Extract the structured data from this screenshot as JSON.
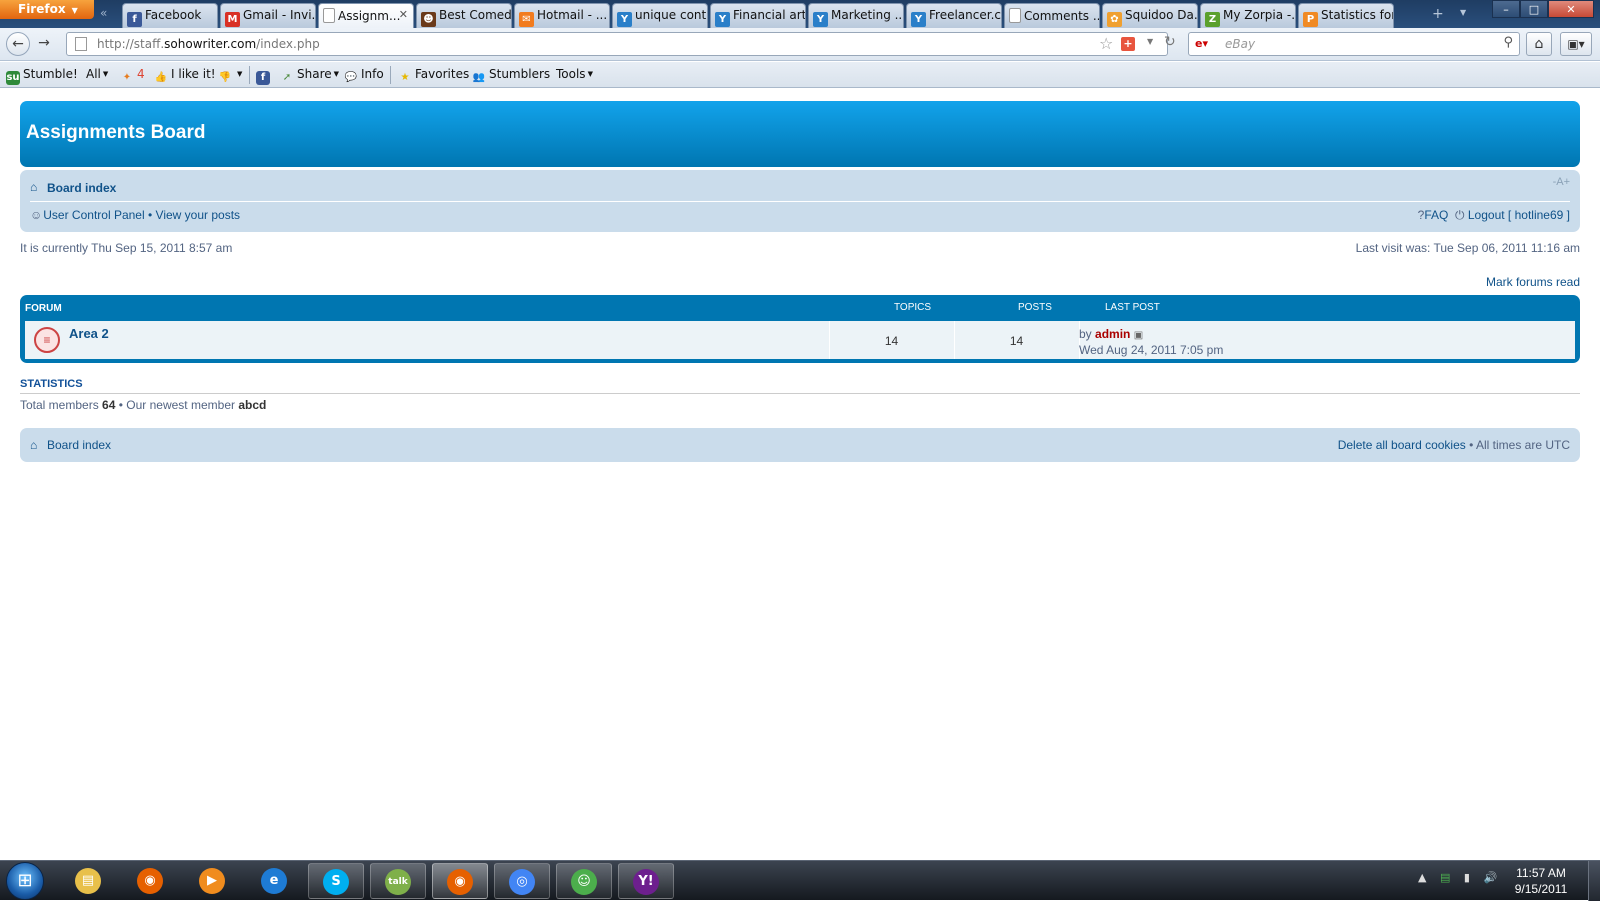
{
  "browser": {
    "app_button": "Firefox",
    "tabs": [
      {
        "title": "Facebook",
        "icon": "facebook-icon",
        "color": "#3b5998",
        "glyph": "f"
      },
      {
        "title": "Gmail - Invi...",
        "icon": "gmail-icon",
        "color": "#d93025",
        "glyph": "M"
      },
      {
        "title": "Assignm...",
        "icon": "page-icon",
        "color": "#ffffff",
        "glyph": "",
        "active": true
      },
      {
        "title": "Best Comed...",
        "icon": "mask-icon",
        "color": "#6b3a1a",
        "glyph": "☻"
      },
      {
        "title": "Hotmail - ...",
        "icon": "hotmail-icon",
        "color": "#f27c1f",
        "glyph": "✉"
      },
      {
        "title": "unique cont...",
        "icon": "yahoo-answers-icon",
        "color": "#2a7fc9",
        "glyph": "Y"
      },
      {
        "title": "Financial art...",
        "icon": "yahoo-answers-icon",
        "color": "#2a7fc9",
        "glyph": "Y"
      },
      {
        "title": "Marketing ...",
        "icon": "yahoo-answers-icon",
        "color": "#2a7fc9",
        "glyph": "Y"
      },
      {
        "title": "Freelancer.c...",
        "icon": "yahoo-answers-icon",
        "color": "#2a7fc9",
        "glyph": "Y"
      },
      {
        "title": "Comments ...",
        "icon": "page-icon",
        "color": "#ffffff",
        "glyph": ""
      },
      {
        "title": "Squidoo Da...",
        "icon": "squidoo-icon",
        "color": "#f0a030",
        "glyph": "✿"
      },
      {
        "title": "My Zorpia -...",
        "icon": "zorpia-icon",
        "color": "#5aa02c",
        "glyph": "Z"
      },
      {
        "title": "Statistics for",
        "icon": "statistics-icon",
        "color": "#f08a24",
        "glyph": "P"
      }
    ],
    "url": {
      "prefix": "http://staff.",
      "domain": "sohowriter.com",
      "path": "/index.php"
    },
    "search_placeholder": "eBay",
    "search_engine": "eBay",
    "window_buttons": {
      "minimize": "–",
      "maximize": "□",
      "close": "✕"
    }
  },
  "stumble_toolbar": {
    "stumble": "Stumble!",
    "all": "All",
    "count": "4",
    "like": "I like it!",
    "share": "Share",
    "info": "Info",
    "favorites": "Favorites",
    "stumblers": "Stumblers",
    "tools": "Tools"
  },
  "forum": {
    "site_title": "Assignments Board",
    "breadcrumb": "Board index",
    "font_resize": "-A+",
    "ucp": "User Control Panel",
    "bullet": "•",
    "view_posts": "View your posts",
    "faq": "FAQ",
    "logout_prefix": "Logout [",
    "username": "hotline69",
    "logout_suffix": "]",
    "current_time": "It is currently Thu Sep 15, 2011 8:57 am",
    "last_visit": "Last visit was: Tue Sep 06, 2011 11:16 am",
    "mark_read": "Mark forums read",
    "table_headers": {
      "forum": "FORUM",
      "topics": "TOPICS",
      "posts": "POSTS",
      "last_post": "LAST POST"
    },
    "rows": [
      {
        "name": "Area 2",
        "topics": "14",
        "posts": "14",
        "last_post_by": "by",
        "last_post_author": "admin",
        "last_post_time": "Wed Aug 24, 2011 7:05 pm"
      }
    ],
    "statistics": {
      "title": "STATISTICS",
      "total_label": "Total members",
      "total_value": "64",
      "newest_label": "• Our newest member",
      "newest_value": "abcd"
    },
    "footer": {
      "board_index": "Board index",
      "delete_cookies": "Delete all board cookies",
      "times": "• All times are UTC"
    },
    "colors": {
      "header_blue": "#0076b1",
      "nav_bg": "#cadceb",
      "link": "#105289",
      "author": "#aa0000"
    }
  },
  "taskbar": {
    "apps": [
      {
        "name": "explorer",
        "icon": "folder-icon",
        "color": "#e8c04a",
        "glyph": "▤",
        "state": ""
      },
      {
        "name": "firefox",
        "icon": "firefox-icon",
        "color": "#e66000",
        "glyph": "◉",
        "state": ""
      },
      {
        "name": "media",
        "icon": "media-player-icon",
        "color": "#f08c1e",
        "glyph": "▶",
        "state": ""
      },
      {
        "name": "ie",
        "icon": "internet-explorer-icon",
        "color": "#1e7bd4",
        "glyph": "e",
        "state": ""
      },
      {
        "name": "skype",
        "icon": "skype-icon",
        "color": "#00aff0",
        "glyph": "S",
        "state": "open"
      },
      {
        "name": "gtalk",
        "icon": "gtalk-icon",
        "color": "#7fb04a",
        "glyph": "talk",
        "state": "open"
      },
      {
        "name": "firefox-active",
        "icon": "firefox-icon",
        "color": "#e66000",
        "glyph": "◉",
        "state": "active"
      },
      {
        "name": "chrome",
        "icon": "chrome-icon",
        "color": "#4285f4",
        "glyph": "◎",
        "state": "open"
      },
      {
        "name": "messenger",
        "icon": "messenger-icon",
        "color": "#4cae4c",
        "glyph": "☺",
        "state": "open"
      },
      {
        "name": "yahoo",
        "icon": "yahoo-messenger-icon",
        "color": "#6d1f8e",
        "glyph": "Y!",
        "state": "open"
      }
    ],
    "time": "11:57 AM",
    "date": "9/15/2011"
  }
}
